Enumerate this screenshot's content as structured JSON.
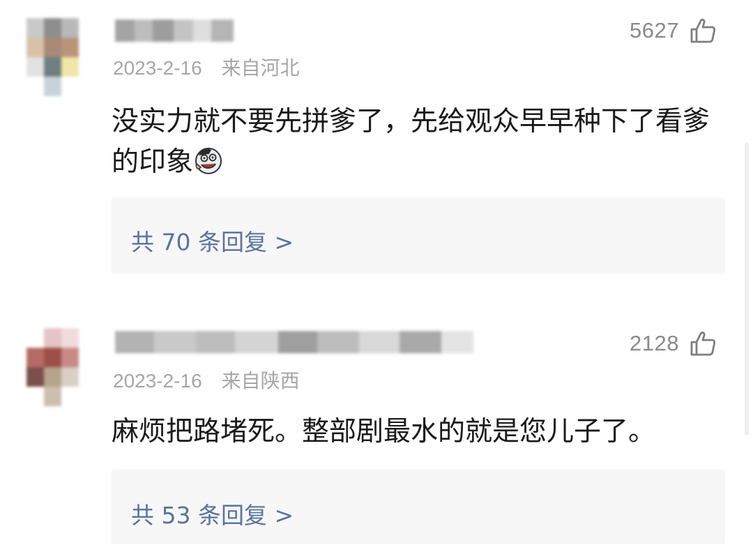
{
  "comments": [
    {
      "likes": "5627",
      "date": "2023-2-16",
      "location": "来自河北",
      "text": "没实力就不要先拼爹了，先给观众早早种下了看爹的印象",
      "emoji": "laughing-face-emoji",
      "replies_label": "共 70 条回复 >"
    },
    {
      "likes": "2128",
      "date": "2023-2-16",
      "location": "来自陕西",
      "text": "麻烦把路堵死。整部剧最水的就是您儿子了。",
      "replies_label": "共 53 条回复 >"
    }
  ],
  "colors": {
    "reply_link": "#5a73a0",
    "meta": "#a6a6a6",
    "like": "#8a8a8a",
    "reply_bg": "#f7f7f7"
  },
  "icons": {
    "like": "thumbs-up-outline-icon"
  }
}
